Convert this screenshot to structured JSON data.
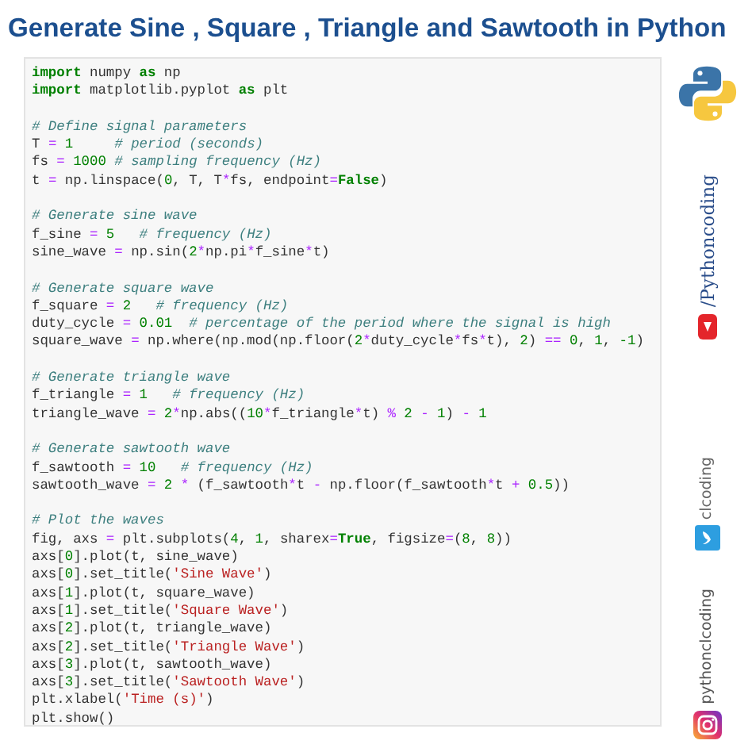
{
  "title": "Generate Sine , Square , Triangle and Sawtooth in Python",
  "code": [
    {
      "kind": "code",
      "tokens": [
        {
          "text": "import",
          "kind": "keyword"
        },
        {
          "text": " numpy ",
          "kind": "plain"
        },
        {
          "text": "as",
          "kind": "keyword"
        },
        {
          "text": " np",
          "kind": "plain"
        }
      ]
    },
    {
      "kind": "code",
      "tokens": [
        {
          "text": "import",
          "kind": "keyword"
        },
        {
          "text": " matplotlib.pyplot ",
          "kind": "plain"
        },
        {
          "text": "as",
          "kind": "keyword"
        },
        {
          "text": " plt",
          "kind": "plain"
        }
      ]
    },
    {
      "kind": "blank"
    },
    {
      "kind": "code",
      "tokens": [
        {
          "text": "# Define signal parameters",
          "kind": "comment"
        }
      ]
    },
    {
      "kind": "code",
      "tokens": [
        {
          "text": "T ",
          "kind": "plain"
        },
        {
          "text": "=",
          "kind": "operator"
        },
        {
          "text": " 1",
          "kind": "number"
        },
        {
          "text": "     # period (seconds)",
          "kind": "comment"
        }
      ]
    },
    {
      "kind": "code",
      "tokens": [
        {
          "text": "fs ",
          "kind": "plain"
        },
        {
          "text": "=",
          "kind": "operator"
        },
        {
          "text": " 1000",
          "kind": "number"
        },
        {
          "text": " # sampling frequency (Hz)",
          "kind": "comment"
        }
      ]
    },
    {
      "kind": "code",
      "tokens": [
        {
          "text": "t ",
          "kind": "plain"
        },
        {
          "text": "=",
          "kind": "operator"
        },
        {
          "text": " np.linspace(",
          "kind": "plain"
        },
        {
          "text": "0",
          "kind": "number"
        },
        {
          "text": ", T, T",
          "kind": "plain"
        },
        {
          "text": "*",
          "kind": "operator"
        },
        {
          "text": "fs, endpoint",
          "kind": "plain"
        },
        {
          "text": "=",
          "kind": "operator"
        },
        {
          "text": "False",
          "kind": "keyword"
        },
        {
          "text": ")",
          "kind": "plain"
        }
      ]
    },
    {
      "kind": "blank"
    },
    {
      "kind": "code",
      "tokens": [
        {
          "text": "# Generate sine wave",
          "kind": "comment"
        }
      ]
    },
    {
      "kind": "code",
      "tokens": [
        {
          "text": "f_sine ",
          "kind": "plain"
        },
        {
          "text": "=",
          "kind": "operator"
        },
        {
          "text": " 5",
          "kind": "number"
        },
        {
          "text": "   # frequency (Hz)",
          "kind": "comment"
        }
      ]
    },
    {
      "kind": "code",
      "tokens": [
        {
          "text": "sine_wave ",
          "kind": "plain"
        },
        {
          "text": "=",
          "kind": "operator"
        },
        {
          "text": " np.sin(",
          "kind": "plain"
        },
        {
          "text": "2",
          "kind": "number"
        },
        {
          "text": "*",
          "kind": "operator"
        },
        {
          "text": "np.pi",
          "kind": "plain"
        },
        {
          "text": "*",
          "kind": "operator"
        },
        {
          "text": "f_sine",
          "kind": "plain"
        },
        {
          "text": "*",
          "kind": "operator"
        },
        {
          "text": "t)",
          "kind": "plain"
        }
      ]
    },
    {
      "kind": "blank"
    },
    {
      "kind": "code",
      "tokens": [
        {
          "text": "# Generate square wave",
          "kind": "comment"
        }
      ]
    },
    {
      "kind": "code",
      "tokens": [
        {
          "text": "f_square ",
          "kind": "plain"
        },
        {
          "text": "=",
          "kind": "operator"
        },
        {
          "text": " 2",
          "kind": "number"
        },
        {
          "text": "   # frequency (Hz)",
          "kind": "comment"
        }
      ]
    },
    {
      "kind": "code",
      "tokens": [
        {
          "text": "duty_cycle ",
          "kind": "plain"
        },
        {
          "text": "=",
          "kind": "operator"
        },
        {
          "text": " 0.01",
          "kind": "number"
        },
        {
          "text": "  # percentage of the period where the signal is high",
          "kind": "comment"
        }
      ]
    },
    {
      "kind": "code",
      "tokens": [
        {
          "text": "square_wave ",
          "kind": "plain"
        },
        {
          "text": "=",
          "kind": "operator"
        },
        {
          "text": " np.where(np.mod(np.floor(",
          "kind": "plain"
        },
        {
          "text": "2",
          "kind": "number"
        },
        {
          "text": "*",
          "kind": "operator"
        },
        {
          "text": "duty_cycle",
          "kind": "plain"
        },
        {
          "text": "*",
          "kind": "operator"
        },
        {
          "text": "fs",
          "kind": "plain"
        },
        {
          "text": "*",
          "kind": "operator"
        },
        {
          "text": "t), ",
          "kind": "plain"
        },
        {
          "text": "2",
          "kind": "number"
        },
        {
          "text": ") ",
          "kind": "plain"
        },
        {
          "text": "==",
          "kind": "operator"
        },
        {
          "text": " 0",
          "kind": "number"
        },
        {
          "text": ", ",
          "kind": "plain"
        },
        {
          "text": "1",
          "kind": "number"
        },
        {
          "text": ", ",
          "kind": "plain"
        },
        {
          "text": "-1",
          "kind": "number"
        },
        {
          "text": ")",
          "kind": "plain"
        }
      ]
    },
    {
      "kind": "blank"
    },
    {
      "kind": "code",
      "tokens": [
        {
          "text": "# Generate triangle wave",
          "kind": "comment"
        }
      ]
    },
    {
      "kind": "code",
      "tokens": [
        {
          "text": "f_triangle ",
          "kind": "plain"
        },
        {
          "text": "=",
          "kind": "operator"
        },
        {
          "text": " 1",
          "kind": "number"
        },
        {
          "text": "   # frequency (Hz)",
          "kind": "comment"
        }
      ]
    },
    {
      "kind": "code",
      "tokens": [
        {
          "text": "triangle_wave ",
          "kind": "plain"
        },
        {
          "text": "=",
          "kind": "operator"
        },
        {
          "text": " 2",
          "kind": "number"
        },
        {
          "text": "*",
          "kind": "operator"
        },
        {
          "text": "np.abs((",
          "kind": "plain"
        },
        {
          "text": "10",
          "kind": "number"
        },
        {
          "text": "*",
          "kind": "operator"
        },
        {
          "text": "f_triangle",
          "kind": "plain"
        },
        {
          "text": "*",
          "kind": "operator"
        },
        {
          "text": "t) ",
          "kind": "plain"
        },
        {
          "text": "%",
          "kind": "operator"
        },
        {
          "text": " 2",
          "kind": "number"
        },
        {
          "text": " -",
          "kind": "operator"
        },
        {
          "text": " 1",
          "kind": "number"
        },
        {
          "text": ") ",
          "kind": "plain"
        },
        {
          "text": "-",
          "kind": "operator"
        },
        {
          "text": " 1",
          "kind": "number"
        }
      ]
    },
    {
      "kind": "blank"
    },
    {
      "kind": "code",
      "tokens": [
        {
          "text": "# Generate sawtooth wave",
          "kind": "comment"
        }
      ]
    },
    {
      "kind": "code",
      "tokens": [
        {
          "text": "f_sawtooth ",
          "kind": "plain"
        },
        {
          "text": "=",
          "kind": "operator"
        },
        {
          "text": " 10",
          "kind": "number"
        },
        {
          "text": "   # frequency (Hz)",
          "kind": "comment"
        }
      ]
    },
    {
      "kind": "code",
      "tokens": [
        {
          "text": "sawtooth_wave ",
          "kind": "plain"
        },
        {
          "text": "=",
          "kind": "operator"
        },
        {
          "text": " 2",
          "kind": "number"
        },
        {
          "text": " *",
          "kind": "operator"
        },
        {
          "text": " (f_sawtooth",
          "kind": "plain"
        },
        {
          "text": "*",
          "kind": "operator"
        },
        {
          "text": "t ",
          "kind": "plain"
        },
        {
          "text": "-",
          "kind": "operator"
        },
        {
          "text": " np.floor(f_sawtooth",
          "kind": "plain"
        },
        {
          "text": "*",
          "kind": "operator"
        },
        {
          "text": "t ",
          "kind": "plain"
        },
        {
          "text": "+",
          "kind": "operator"
        },
        {
          "text": " 0.5",
          "kind": "number"
        },
        {
          "text": "))",
          "kind": "plain"
        }
      ]
    },
    {
      "kind": "blank"
    },
    {
      "kind": "code",
      "tokens": [
        {
          "text": "# Plot the waves",
          "kind": "comment"
        }
      ]
    },
    {
      "kind": "code",
      "tokens": [
        {
          "text": "fig, axs ",
          "kind": "plain"
        },
        {
          "text": "=",
          "kind": "operator"
        },
        {
          "text": " plt.subplots(",
          "kind": "plain"
        },
        {
          "text": "4",
          "kind": "number"
        },
        {
          "text": ", ",
          "kind": "plain"
        },
        {
          "text": "1",
          "kind": "number"
        },
        {
          "text": ", sharex",
          "kind": "plain"
        },
        {
          "text": "=",
          "kind": "operator"
        },
        {
          "text": "True",
          "kind": "keyword"
        },
        {
          "text": ", figsize",
          "kind": "plain"
        },
        {
          "text": "=",
          "kind": "operator"
        },
        {
          "text": "(",
          "kind": "plain"
        },
        {
          "text": "8",
          "kind": "number"
        },
        {
          "text": ", ",
          "kind": "plain"
        },
        {
          "text": "8",
          "kind": "number"
        },
        {
          "text": "))",
          "kind": "plain"
        }
      ]
    },
    {
      "kind": "code",
      "tokens": [
        {
          "text": "axs[",
          "kind": "plain"
        },
        {
          "text": "0",
          "kind": "number"
        },
        {
          "text": "].plot(t, sine_wave)",
          "kind": "plain"
        }
      ]
    },
    {
      "kind": "code",
      "tokens": [
        {
          "text": "axs[",
          "kind": "plain"
        },
        {
          "text": "0",
          "kind": "number"
        },
        {
          "text": "].set_title(",
          "kind": "plain"
        },
        {
          "text": "'Sine Wave'",
          "kind": "string"
        },
        {
          "text": ")",
          "kind": "plain"
        }
      ]
    },
    {
      "kind": "code",
      "tokens": [
        {
          "text": "axs[",
          "kind": "plain"
        },
        {
          "text": "1",
          "kind": "number"
        },
        {
          "text": "].plot(t, square_wave)",
          "kind": "plain"
        }
      ]
    },
    {
      "kind": "code",
      "tokens": [
        {
          "text": "axs[",
          "kind": "plain"
        },
        {
          "text": "1",
          "kind": "number"
        },
        {
          "text": "].set_title(",
          "kind": "plain"
        },
        {
          "text": "'Square Wave'",
          "kind": "string"
        },
        {
          "text": ")",
          "kind": "plain"
        }
      ]
    },
    {
      "kind": "code",
      "tokens": [
        {
          "text": "axs[",
          "kind": "plain"
        },
        {
          "text": "2",
          "kind": "number"
        },
        {
          "text": "].plot(t, triangle_wave)",
          "kind": "plain"
        }
      ]
    },
    {
      "kind": "code",
      "tokens": [
        {
          "text": "axs[",
          "kind": "plain"
        },
        {
          "text": "2",
          "kind": "number"
        },
        {
          "text": "].set_title(",
          "kind": "plain"
        },
        {
          "text": "'Triangle Wave'",
          "kind": "string"
        },
        {
          "text": ")",
          "kind": "plain"
        }
      ]
    },
    {
      "kind": "code",
      "tokens": [
        {
          "text": "axs[",
          "kind": "plain"
        },
        {
          "text": "3",
          "kind": "number"
        },
        {
          "text": "].plot(t, sawtooth_wave)",
          "kind": "plain"
        }
      ]
    },
    {
      "kind": "code",
      "tokens": [
        {
          "text": "axs[",
          "kind": "plain"
        },
        {
          "text": "3",
          "kind": "number"
        },
        {
          "text": "].set_title(",
          "kind": "plain"
        },
        {
          "text": "'Sawtooth Wave'",
          "kind": "string"
        },
        {
          "text": ")",
          "kind": "plain"
        }
      ]
    },
    {
      "kind": "code",
      "tokens": [
        {
          "text": "plt.xlabel(",
          "kind": "plain"
        },
        {
          "text": "'Time (s)'",
          "kind": "string"
        },
        {
          "text": ")",
          "kind": "plain"
        }
      ]
    },
    {
      "kind": "code",
      "tokens": [
        {
          "text": "plt.show()",
          "kind": "plain"
        }
      ]
    }
  ],
  "social": [
    {
      "kind": "youtube",
      "handle": "/Pythoncoding"
    },
    {
      "kind": "twitter",
      "handle": "clcoding"
    },
    {
      "kind": "instagram",
      "handle": "pythonclcoding"
    }
  ]
}
